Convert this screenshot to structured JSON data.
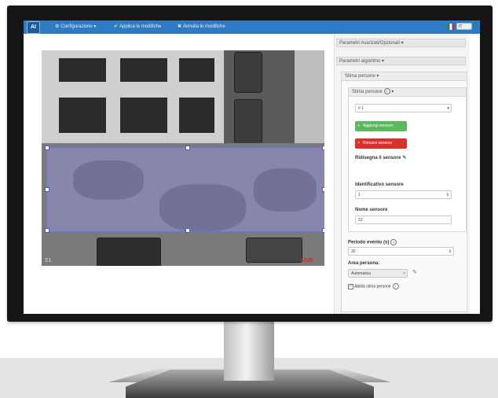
{
  "app": {
    "logo_text": "AI",
    "nav": {
      "config_label": "Configurazione",
      "apply_label": "Applica le modifiche",
      "cancel_label": "Annulla le modifiche",
      "language": "IT"
    }
  },
  "panel": {
    "section_advanced": "Parametri Avanzati/Opzionali",
    "section_algorithm": "Parametri algoritmo",
    "section_people": "Stima persone",
    "sensor_box_title": "Stima persone",
    "sensor_select_value": "# 1",
    "add_sensor_label": "Aggiungi sensore",
    "remove_sensor_label": "Rimuovi sensore",
    "redraw_label": "Ridisegna il sensore",
    "id_label": "Identificativo sensore",
    "id_value": "1",
    "name_label": "Nome sensore",
    "name_value": "S1",
    "period_label": "Periodo evento (s)",
    "period_value": "30",
    "area_label": "Area persona:",
    "area_value": "Automatica",
    "enable_label": "Abilita stima persone"
  },
  "video": {
    "overlay_left": "S1",
    "overlay_right": "LIVE"
  },
  "colors": {
    "navbar": "#2e7bc4",
    "roi": "#9696eb",
    "add_button": "#5cb85c",
    "remove_button": "#d9302c"
  }
}
